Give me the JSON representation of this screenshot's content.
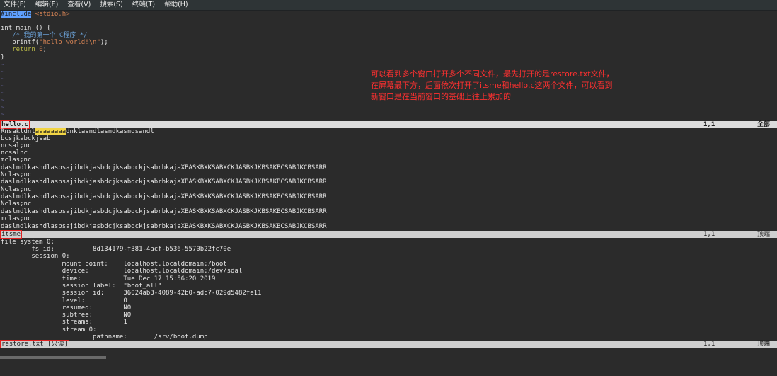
{
  "menubar": {
    "items": [
      "文件(F)",
      "编辑(E)",
      "查看(V)",
      "搜索(S)",
      "终端(T)",
      "帮助(H)"
    ]
  },
  "window1": {
    "code": {
      "include_kw": "#include",
      "include_hdr": "<stdio.h>",
      "main_sig": "int main () {",
      "comment": "   /* 我的第一个 C程序 */",
      "printf_pre": "   printf(",
      "printf_str": "\"hello world!\\n\"",
      "printf_post": ");",
      "return_pre": "   return ",
      "return_val": "0",
      "return_post": ";",
      "close_brace": "}"
    },
    "tilde": "~",
    "status": {
      "filename": "hello.c",
      "position": "1,1",
      "scroll": "全部"
    }
  },
  "window2": {
    "lines": [
      "bcsjkabckjsab",
      "ncsal;nc",
      "ncsalnc",
      "mclas;nc",
      "daslndlkashdlasbsajibdkjasbdcjksabdckjsabrbkajaXBASKBXKSABXCKJASBKJKBSAKBCSABJKCBSARR",
      "Nclas;nc",
      "daslndlkashdlasbsajibdkjasbdcjksabdckjsabrbkajaXBASKBXKSABXCKJASBKJKBSAKBCSABJKCBSARR",
      "Nclas;nc",
      "daslndlkashdlasbsajibdkjasbdcjksabdckjsabrbkajaXBASKBXKSABXCKJASBKJKBSAKBCSABJKCBSARR",
      "Nclas;nc",
      "daslndlkashdlasbsajibdkjasbdcjksabdckjsabrbkajaXBASKBXKSABXCKJASBKJKBSAKBCSABJKCBSARR",
      "mclas;nc",
      "daslndlkashdlasbsajibdkjasbdcjksabdckjsabrbkajaXBASKBXKSABXCKJASBKJKBSAKBCSABJKCBSARR"
    ],
    "first_line_pre": "Rnsakldnl",
    "first_line_hl": "aaaaaaaa",
    "first_line_post": "dnklasndlasndkasndsandl",
    "status": {
      "filename": "itsme",
      "position": "1,1",
      "scroll": "顶端"
    }
  },
  "window3": {
    "lines": [
      "file system 0:",
      "        fs id:          8d134179-f381-4acf-b536-5570b22fc70e",
      "        session 0:",
      "                mount point:    localhost.localdomain:/boot",
      "                device:         localhost.localdomain:/dev/sdal",
      "                time:           Tue Dec 17 15:56:20 2019",
      "                session label:  \"boot_all\"",
      "                session id:     36024ab3-4089-42b0-adc7-029d5482fe11",
      "                level:          0",
      "                resumed:        NO",
      "                subtree:        NO",
      "                streams:        1",
      "                stream 0:",
      "                        pathname:       /srv/boot.dump"
    ],
    "status": {
      "filename": "restore.txt [只读]",
      "position": "1,1",
      "scroll": "顶端"
    }
  },
  "annotation": {
    "lines": [
      "可以看到多个窗口打开多个不同文件，最先打开的是restore.txt文件，",
      "在屏幕最下方，后面依次打开了itsme和hello.c这两个文件，可以看到",
      "新窗口是在当前窗口的基础上往上累加的"
    ]
  }
}
